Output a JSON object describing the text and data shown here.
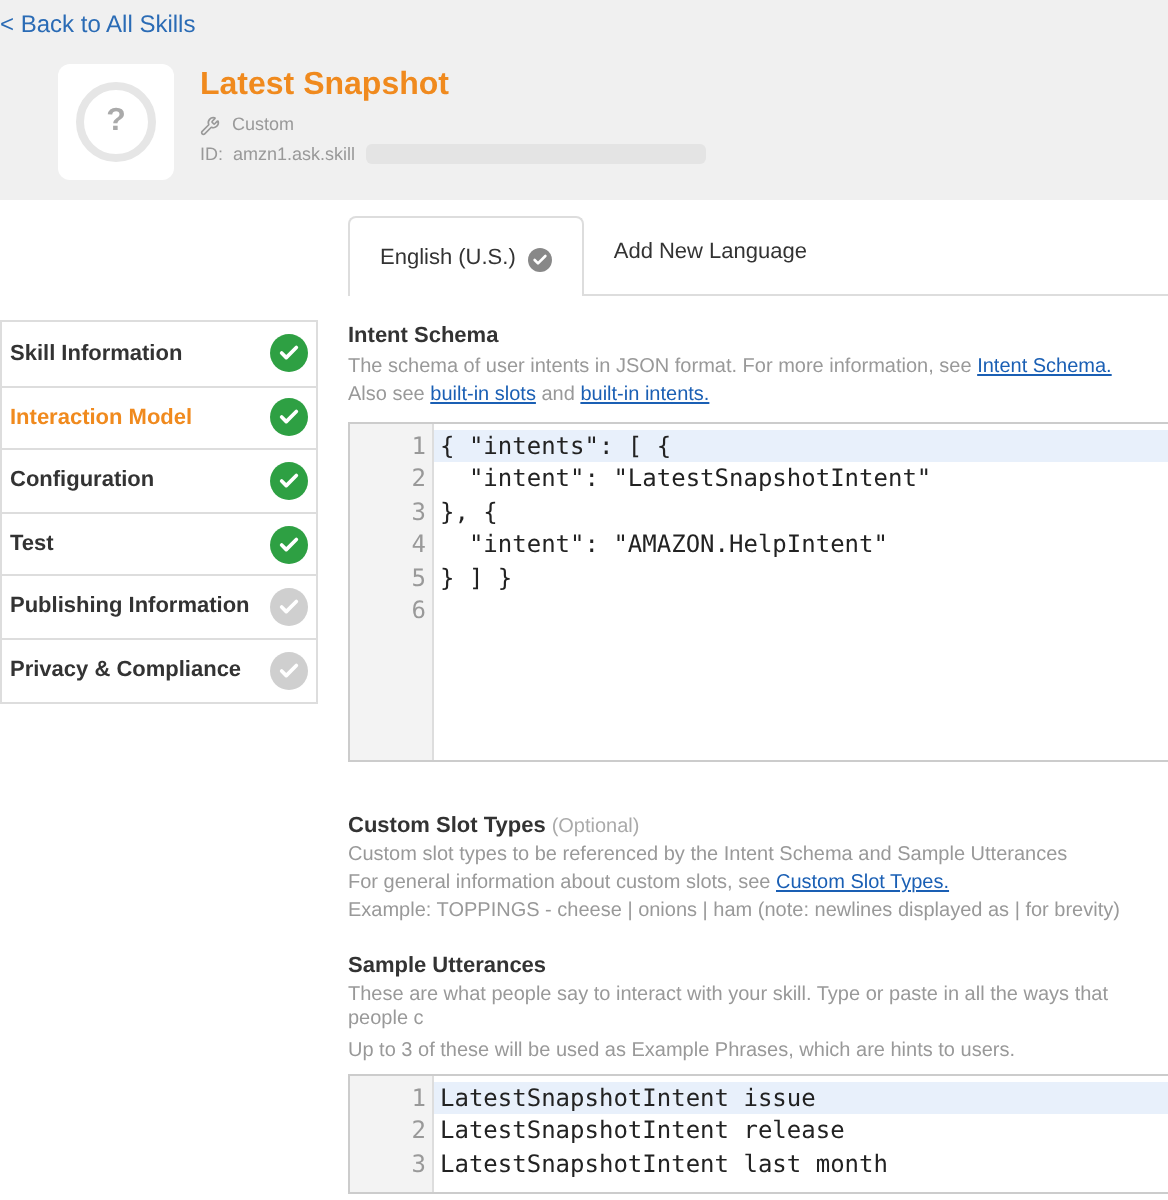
{
  "back_link": "< Back to All Skills",
  "skill": {
    "avatar_glyph": "?",
    "title": "Latest Snapshot",
    "type": "Custom",
    "id_label": "ID:",
    "id_value": "amzn1.ask.skill"
  },
  "tabs": [
    {
      "label": "English (U.S.)",
      "selected": true,
      "verified": true
    },
    {
      "label": "Add New Language",
      "selected": false,
      "verified": false
    }
  ],
  "sidebar": {
    "items": [
      {
        "label": "Skill Information",
        "selected": false,
        "complete": true
      },
      {
        "label": "Interaction Model",
        "selected": true,
        "complete": true
      },
      {
        "label": "Configuration",
        "selected": false,
        "complete": true
      },
      {
        "label": "Test",
        "selected": false,
        "complete": true
      },
      {
        "label": "Publishing Information",
        "selected": false,
        "complete": false
      },
      {
        "label": "Privacy & Compliance",
        "selected": false,
        "complete": false
      }
    ]
  },
  "intent_schema": {
    "title": "Intent Schema",
    "description": [
      {
        "text": "The schema of user intents in JSON format. For more information, see "
      },
      {
        "link": "Intent Schema."
      }
    ],
    "description_2": [
      {
        "text": "Also see "
      },
      {
        "link": "built-in slots"
      },
      {
        "text": " and "
      },
      {
        "link": "built-in intents."
      }
    ],
    "editor": {
      "lines": [
        {
          "number": "1",
          "code": "{ \"intents\": [ {",
          "highlighted": true
        },
        {
          "number": "2",
          "code": "  \"intent\": \"LatestSnapshotIntent\"",
          "highlighted": false
        },
        {
          "number": "3",
          "code": "}, {",
          "highlighted": false
        },
        {
          "number": "4",
          "code": "  \"intent\": \"AMAZON.HelpIntent\"",
          "highlighted": false
        },
        {
          "number": "5",
          "code": "} ] }",
          "highlighted": false
        },
        {
          "number": "6",
          "highlighted": false
        }
      ]
    }
  },
  "custom_slot_types": {
    "title": "Custom Slot Types",
    "optional": "(Optional)",
    "lines": [
      [
        {
          "text": "Custom slot types to be referenced by the Intent Schema and Sample Utterances"
        }
      ],
      [
        {
          "text": "For general information about custom slots, see "
        },
        {
          "link": "Custom Slot Types."
        }
      ],
      [
        {
          "text": "Example: TOPPINGS - cheese | onions | ham (note: newlines displayed as | for brevity)"
        }
      ]
    ]
  },
  "sample_utterances": {
    "title": "Sample Utterances",
    "description": "These are what people say to interact with your skill. Type or paste in all the ways that people c",
    "note": "Up to 3 of these will be used as Example Phrases, which are hints to users.",
    "editor": {
      "lines": [
        {
          "number": "1",
          "code": "LatestSnapshotIntent issue",
          "highlighted": true
        },
        {
          "number": "2",
          "code": "LatestSnapshotIntent release",
          "highlighted": false
        },
        {
          "number": "3",
          "code": "LatestSnapshotIntent last month",
          "highlighted": false
        }
      ]
    }
  }
}
